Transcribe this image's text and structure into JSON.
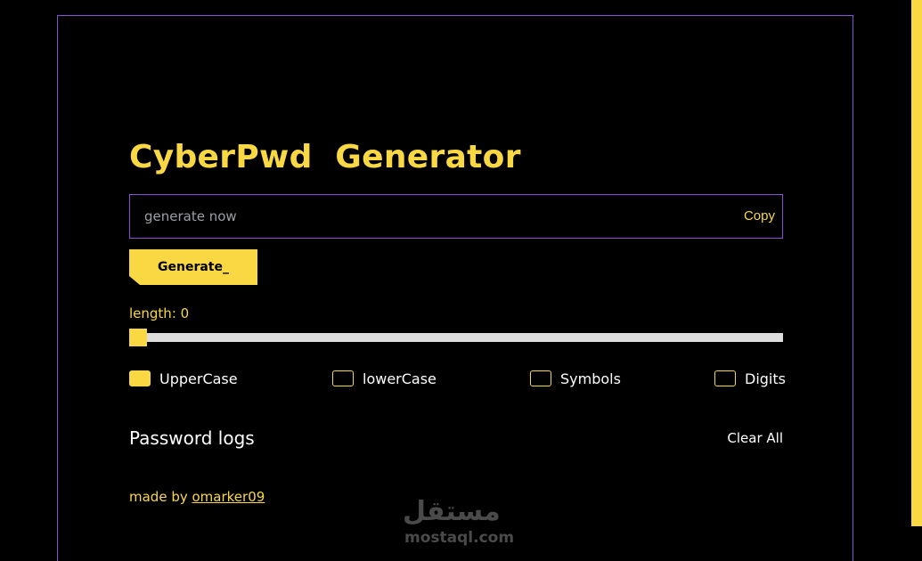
{
  "app": {
    "title": "CyberPwd  Generator"
  },
  "password": {
    "value": "",
    "placeholder": "generate now",
    "copy_label": "Copy"
  },
  "generate_label": "Generate_",
  "length": {
    "label": "length: 0",
    "value": 0
  },
  "options": [
    {
      "label": "UpperCase",
      "checked": true
    },
    {
      "label": "lowerCase",
      "checked": false
    },
    {
      "label": "Symbols",
      "checked": false
    },
    {
      "label": "Digits",
      "checked": false
    }
  ],
  "logs": {
    "title": "Password logs",
    "clear_label": "Clear All"
  },
  "footer": {
    "prefix": "made by ",
    "author": "omarker09"
  },
  "watermark": {
    "arabic": "مستقل",
    "latin": "mostaql.com"
  },
  "colors": {
    "accent": "#f9d843",
    "frame": "#8a4fd6",
    "background": "#000000"
  }
}
